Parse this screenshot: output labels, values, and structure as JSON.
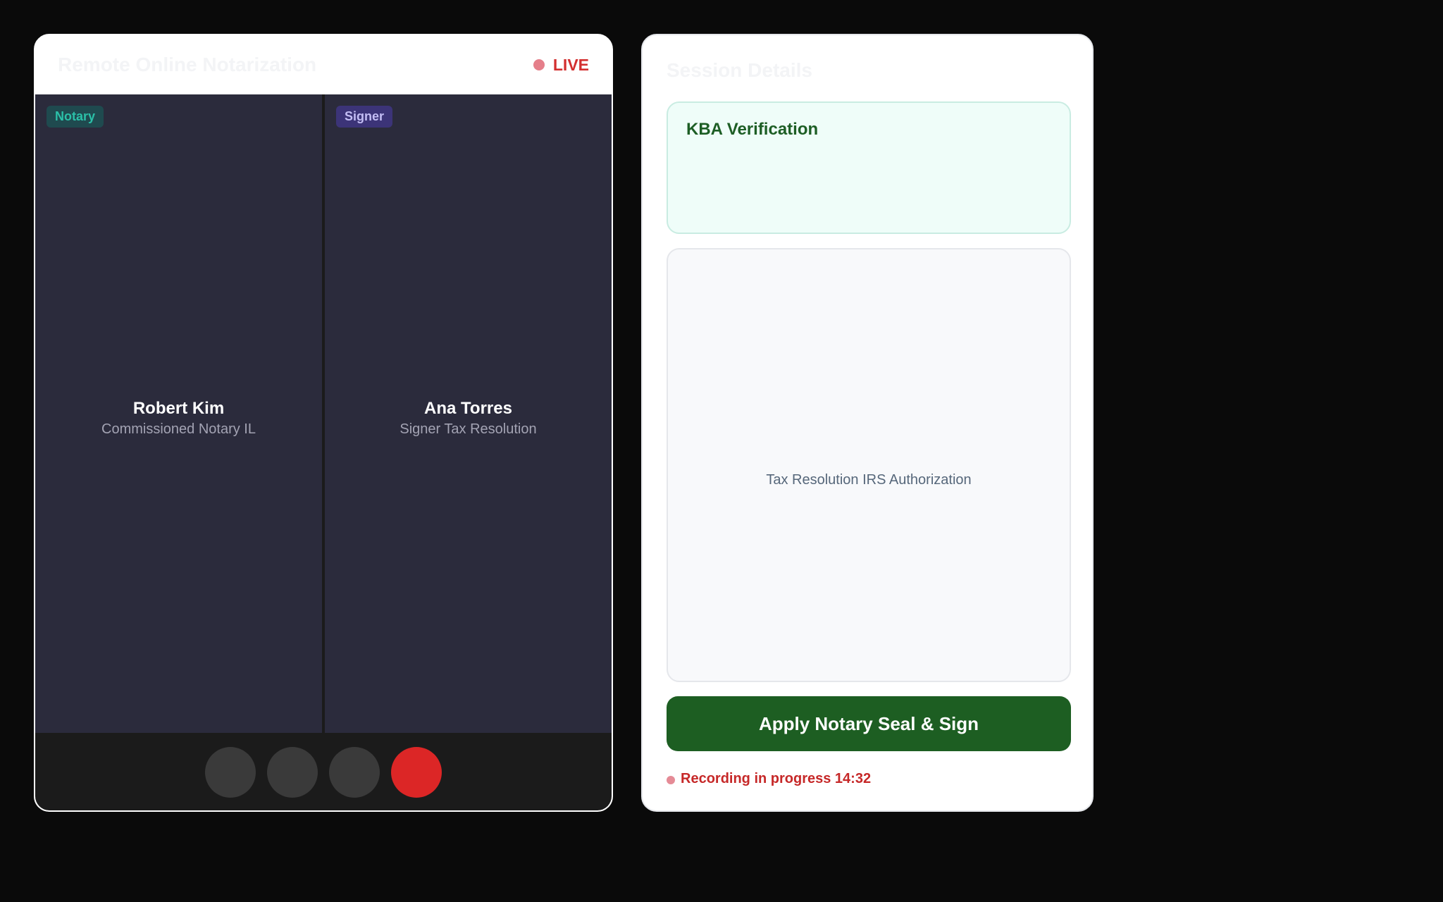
{
  "video": {
    "title": "Remote Online Notarization",
    "live_label": "LIVE",
    "participants": [
      {
        "tag": "Notary",
        "name": "Robert Kim",
        "role": "Commissioned Notary IL"
      },
      {
        "tag": "Signer",
        "name": "Ana Torres",
        "role": "Signer Tax Resolution"
      }
    ],
    "controls": [
      {
        "icon": "microphone-icon"
      },
      {
        "icon": "camera-icon"
      },
      {
        "icon": "share-screen-icon"
      },
      {
        "icon": "end-call-icon"
      }
    ]
  },
  "details": {
    "title": "Session Details",
    "kba": {
      "title": "KBA Verification"
    },
    "document": {
      "name": "Tax Resolution IRS Authorization"
    },
    "seal_button": "Apply Notary Seal & Sign",
    "recording": "Recording in progress 14:32"
  },
  "colors": {
    "background": "#0a0a0a",
    "live_red": "#d32f2f",
    "seal_green": "#1d5e22",
    "kba_green": "#1d5e25",
    "end_call_red": "#dc2626"
  }
}
